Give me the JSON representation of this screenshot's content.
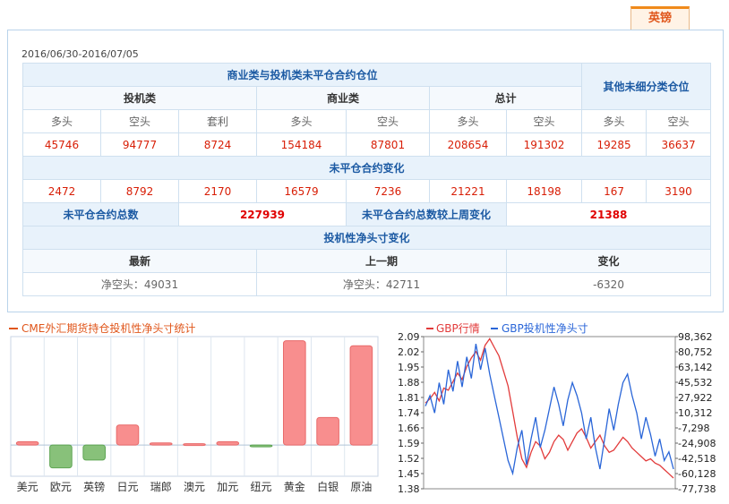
{
  "tab": {
    "label": "英镑"
  },
  "date_range": "2016/06/30-2016/07/05",
  "table": {
    "title_main": "商业类与投机类未平仓合约仓位",
    "title_other": "其他未细分类仓位",
    "groups": {
      "spec": "投机类",
      "comm": "商业类",
      "total": "总计"
    },
    "cols": [
      "多头",
      "空头",
      "套利",
      "多头",
      "空头",
      "多头",
      "空头",
      "多头",
      "空头"
    ],
    "row1": [
      "45746",
      "94777",
      "8724",
      "154184",
      "87801",
      "208654",
      "191302",
      "19285",
      "36637"
    ],
    "change_title": "未平仓合约变化",
    "row2": [
      "2472",
      "8792",
      "2170",
      "16579",
      "7236",
      "21221",
      "18198",
      "167",
      "3190"
    ],
    "total_label": "未平仓合约总数",
    "total_value": "227939",
    "week_change_label": "未平仓合约总数较上周变化",
    "week_change_value": "21388",
    "net_title": "投机性净头寸变化",
    "net_cols": [
      "最新",
      "上一期",
      "变化"
    ],
    "net_vals": [
      "净空头：49031",
      "净空头：42711",
      "-6320"
    ]
  },
  "bar_chart": {
    "legend": "CME外汇期货持仓投机性净头寸统计",
    "chart_data": {
      "type": "bar",
      "categories": [
        "美元",
        "欧元",
        "英镑",
        "日元",
        "瑞郎",
        "澳元",
        "加元",
        "纽元",
        "黄金",
        "白银",
        "原油"
      ],
      "values": [
        8,
        -55,
        -36,
        48,
        5,
        3,
        8,
        -2,
        250,
        66,
        238
      ],
      "ylim": [
        -75,
        260
      ]
    }
  },
  "line_chart": {
    "legend_red": "GBP行情",
    "legend_blue": "GBP投机性净头寸",
    "left_ticks": [
      "2.09",
      "2.02",
      "1.95",
      "1.88",
      "1.81",
      "1.74",
      "1.66",
      "1.59",
      "1.52",
      "1.45",
      "1.38"
    ],
    "right_ticks": [
      "98,362",
      "80,752",
      "63,142",
      "45,532",
      "27,922",
      "10,312",
      "-7,298",
      "-24,908",
      "-42,518",
      "-60,128",
      "-77,738"
    ],
    "chart_data": {
      "type": "line",
      "series": [
        {
          "name": "GBP行情",
          "color": "#e23b3b",
          "values": [
            1.78,
            1.8,
            1.83,
            1.79,
            1.85,
            1.84,
            1.88,
            1.92,
            1.89,
            1.95,
            1.99,
            2.02,
            1.98,
            2.05,
            2.08,
            2.04,
            2.0,
            1.93,
            1.86,
            1.74,
            1.62,
            1.52,
            1.48,
            1.55,
            1.6,
            1.58,
            1.52,
            1.55,
            1.6,
            1.63,
            1.61,
            1.56,
            1.6,
            1.64,
            1.66,
            1.62,
            1.57,
            1.6,
            1.63,
            1.58,
            1.55,
            1.56,
            1.59,
            1.62,
            1.6,
            1.57,
            1.55,
            1.53,
            1.51,
            1.52,
            1.5,
            1.49,
            1.47,
            1.45,
            1.43
          ]
        },
        {
          "name": "GBP投机性净头寸",
          "color": "#2a66d8",
          "values": [
            18000,
            30000,
            10000,
            45000,
            20000,
            60000,
            35000,
            70000,
            40000,
            75000,
            50000,
            90000,
            60000,
            85000,
            55000,
            30000,
            5000,
            -20000,
            -45000,
            -60000,
            -30000,
            -10000,
            -50000,
            -20000,
            5000,
            -30000,
            -10000,
            15000,
            40000,
            20000,
            -5000,
            25000,
            45000,
            30000,
            10000,
            -20000,
            5000,
            -30000,
            -55000,
            -20000,
            15000,
            -10000,
            20000,
            45000,
            55000,
            30000,
            10000,
            -20000,
            5000,
            -15000,
            -40000,
            -20000,
            -45000,
            -35000,
            -55000
          ]
        }
      ],
      "ylim_left": [
        1.38,
        2.09
      ],
      "ylim_right": [
        -77738,
        98362
      ]
    }
  }
}
